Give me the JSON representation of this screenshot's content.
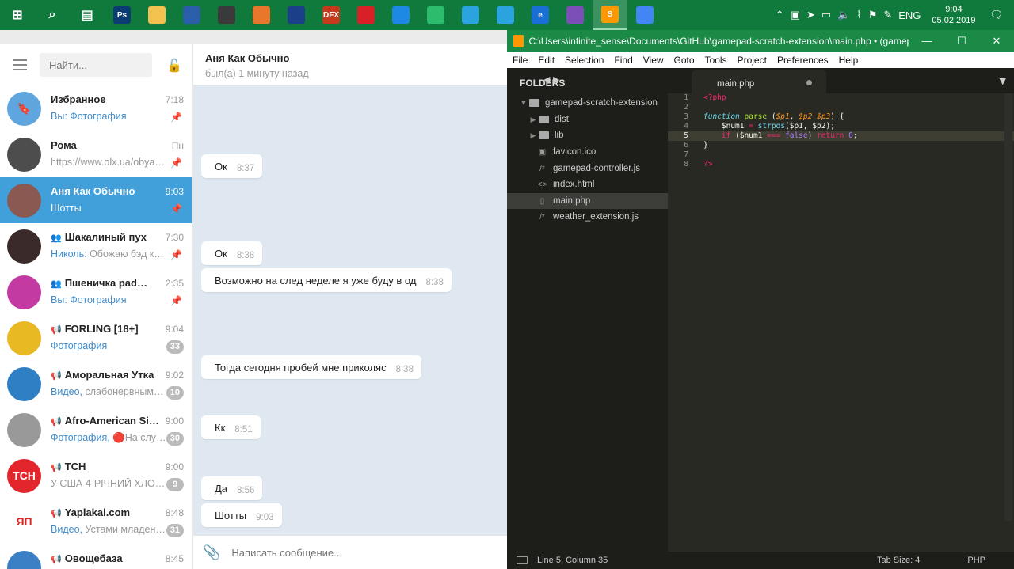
{
  "taskbar": {
    "apps": [
      {
        "name": "start",
        "label": "",
        "color": "#0f7a3c"
      },
      {
        "name": "search",
        "label": "",
        "color": "#0f7a3c"
      },
      {
        "name": "task-view",
        "label": "",
        "color": "#0f7a3c"
      },
      {
        "name": "photoshop",
        "label": "Ps",
        "color": "#0a3b72"
      },
      {
        "name": "file-explorer",
        "label": "",
        "color": "#f2c14e"
      },
      {
        "name": "floppy",
        "label": "",
        "color": "#2a5ea8"
      },
      {
        "name": "calculator",
        "label": "",
        "color": "#3a3a3a"
      },
      {
        "name": "media",
        "label": "",
        "color": "#e8762b"
      },
      {
        "name": "app-dd",
        "label": "",
        "color": "#1c3f8a"
      },
      {
        "name": "dfx",
        "label": "DFX",
        "color": "#c43a1b"
      },
      {
        "name": "app-red",
        "label": "",
        "color": "#d92027"
      },
      {
        "name": "app-blue",
        "label": "",
        "color": "#1e88e5"
      },
      {
        "name": "app-green",
        "label": "",
        "color": "#2dbb6e"
      },
      {
        "name": "telegram-1",
        "label": "",
        "color": "#2aa3de"
      },
      {
        "name": "telegram-2",
        "label": "",
        "color": "#2aa3de"
      },
      {
        "name": "edge",
        "label": "e",
        "color": "#1a6fd6"
      },
      {
        "name": "app-purple",
        "label": "",
        "color": "#7b4fb7"
      },
      {
        "name": "sublime",
        "label": "S",
        "color": "#ff9800"
      },
      {
        "name": "chrome",
        "label": "",
        "color": "#4285f4"
      }
    ],
    "tray": {
      "lang": "ENG",
      "time": "9:04",
      "date": "05.02.2019"
    }
  },
  "telegram": {
    "search_placeholder": "Найти...",
    "chats": [
      {
        "name": "Избранное",
        "time": "7:18",
        "prefix": "Вы: Фотография",
        "preview": "",
        "pinned": true,
        "badge": "",
        "active": false,
        "group": "",
        "avatar_color": "#5ea6dd",
        "avatar_text": "🔖"
      },
      {
        "name": "Рома",
        "time": "Пн",
        "prefix": "",
        "preview": "https://www.olx.ua/obyavl…",
        "pinned": true,
        "badge": "",
        "active": false,
        "group": "",
        "avatar_color": "#4d4d4d",
        "avatar_text": ""
      },
      {
        "name": "Аня Как Обычно",
        "time": "9:03",
        "prefix": "",
        "preview": "Шотты",
        "pinned": true,
        "badge": "",
        "active": true,
        "group": "",
        "avatar_color": "#8a5a52",
        "avatar_text": ""
      },
      {
        "name": "Шакалиный пух",
        "time": "7:30",
        "prefix": "Николь: ",
        "preview": "Обожаю бэд к…",
        "pinned": true,
        "badge": "",
        "active": false,
        "group": "group",
        "avatar_color": "#3b2a2a",
        "avatar_text": ""
      },
      {
        "name": "Пшеничка pad…",
        "time": "2:35",
        "prefix": "Вы: Фотография",
        "preview": "",
        "pinned": true,
        "badge": "",
        "active": false,
        "group": "group",
        "avatar_color": "#c43aa3",
        "avatar_text": ""
      },
      {
        "name": "FORLING [18+]",
        "time": "9:04",
        "prefix": "Фотография",
        "preview": "",
        "pinned": false,
        "badge": "33",
        "active": false,
        "group": "channel",
        "avatar_color": "#e8b923",
        "avatar_text": ""
      },
      {
        "name": "Аморальная Утка",
        "time": "9:02",
        "prefix": "Видео, ",
        "preview": "слабонервным…",
        "pinned": false,
        "badge": "10",
        "active": false,
        "group": "channel",
        "avatar_color": "#2e7fc4",
        "avatar_text": ""
      },
      {
        "name": "Afro-American Sid…",
        "time": "9:00",
        "prefix": "Фотография, ",
        "preview": "🔴На слу…",
        "pinned": false,
        "badge": "30",
        "active": false,
        "group": "channel",
        "avatar_color": "#999999",
        "avatar_text": ""
      },
      {
        "name": "ТСН",
        "time": "9:00",
        "prefix": "",
        "preview": "У США 4-РІЧНИЙ ХЛОП…",
        "pinned": false,
        "badge": "9",
        "active": false,
        "group": "channel",
        "avatar_color": "#e3262b",
        "avatar_text": "ТСН"
      },
      {
        "name": "Yaplakal.com",
        "time": "8:48",
        "prefix": "Видео, ",
        "preview": "Устами младен…",
        "pinned": false,
        "badge": "31",
        "active": false,
        "group": "channel",
        "avatar_color": "#ffffff",
        "avatar_text": "ЯП"
      },
      {
        "name": "Овощебаза",
        "time": "8:45",
        "prefix": "",
        "preview": "",
        "pinned": false,
        "badge": "",
        "active": false,
        "group": "channel",
        "avatar_color": "#3b7fc4",
        "avatar_text": ""
      }
    ],
    "chat_header": {
      "title": "Аня Как Обычно",
      "status": "был(а) 1 минуту назад"
    },
    "messages": [
      {
        "text": "Ок",
        "time": "8:37"
      },
      {
        "text": "Ок",
        "time": "8:38"
      },
      {
        "text": "Возможно на след неделе я уже буду в од",
        "time": "8:38"
      },
      {
        "text": "Тогда сегодня пробей мне приколяс",
        "time": "8:38"
      },
      {
        "text": "Кк",
        "time": "8:51"
      },
      {
        "text": "Да",
        "time": "8:56"
      },
      {
        "text": "Шотты",
        "time": "9:03"
      }
    ],
    "compose_placeholder": "Написать сообщение..."
  },
  "sublime": {
    "title": "C:\\Users\\infinite_sense\\Documents\\GitHub\\gamepad-scratch-extension\\main.php • (gamepad…",
    "menu": [
      "File",
      "Edit",
      "Selection",
      "Find",
      "View",
      "Goto",
      "Tools",
      "Project",
      "Preferences",
      "Help"
    ],
    "sidebar_header": "FOLDERS",
    "tree": [
      {
        "label": "gamepad-scratch-extension",
        "type": "folder-open"
      },
      {
        "label": "dist",
        "type": "folder"
      },
      {
        "label": "lib",
        "type": "folder"
      },
      {
        "label": "favicon.ico",
        "type": "image"
      },
      {
        "label": "gamepad-controller.js",
        "type": "code"
      },
      {
        "label": "index.html",
        "type": "html"
      },
      {
        "label": "main.php",
        "type": "file"
      },
      {
        "label": "weather_extension.js",
        "type": "code"
      }
    ],
    "tab": "main.php",
    "line_numbers": [
      "1",
      "2",
      "3",
      "4",
      "5",
      "6",
      "7",
      "8"
    ],
    "status": {
      "position": "Line 5, Column 35",
      "tab_size": "Tab Size: 4",
      "syntax": "PHP"
    }
  }
}
